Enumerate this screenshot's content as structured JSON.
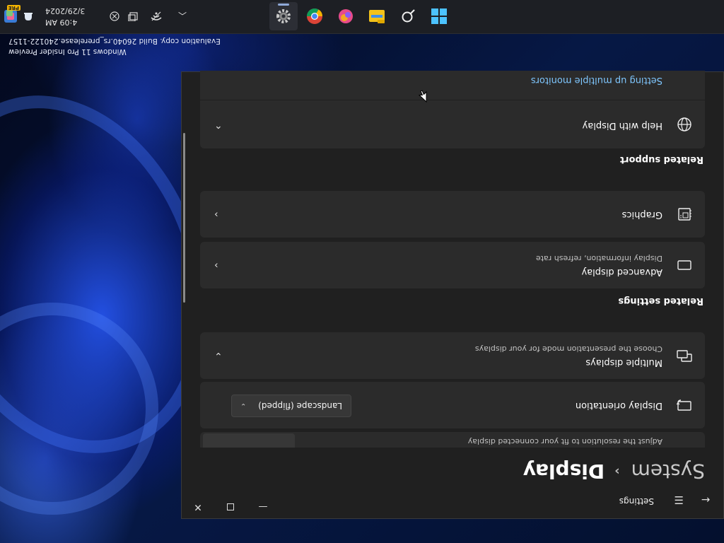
{
  "desktop": {
    "watermark_line1": "Windows 11 Pro Insider Preview",
    "watermark_line2": "Evaluation copy. Build 26040.rs_prerelease.240122-1157"
  },
  "taskbar": {
    "apps": [
      "start-icon",
      "search-icon",
      "file-explorer-icon",
      "copilot-icon",
      "chrome-icon",
      "settings-icon"
    ],
    "clock_time": "4:09 AM",
    "clock_date": "3/29/2024",
    "pre_badge": "PRE"
  },
  "window": {
    "app_title": "Settings",
    "breadcrumb_parent": "System",
    "breadcrumb_current": "Display",
    "resolution_subtitle": "Adjust the resolution to fit your connected display",
    "orientation_label": "Display orientation",
    "orientation_value": "Landscape (flipped)",
    "multiple_displays_title": "Multiple displays",
    "multiple_displays_subtitle": "Choose the presentation mode for your displays",
    "related_settings_header": "Related settings",
    "advanced_display_title": "Advanced display",
    "advanced_display_subtitle": "Display information, refresh rate",
    "graphics_title": "Graphics",
    "related_support_header": "Related support",
    "help_display_title": "Help with Display",
    "help_link": "Setting up multiple monitors"
  },
  "colors": {
    "window_bg": "#202020",
    "card_bg": "#2b2b2b",
    "link": "#7fc7ff",
    "accent": "#4cc2ff"
  }
}
